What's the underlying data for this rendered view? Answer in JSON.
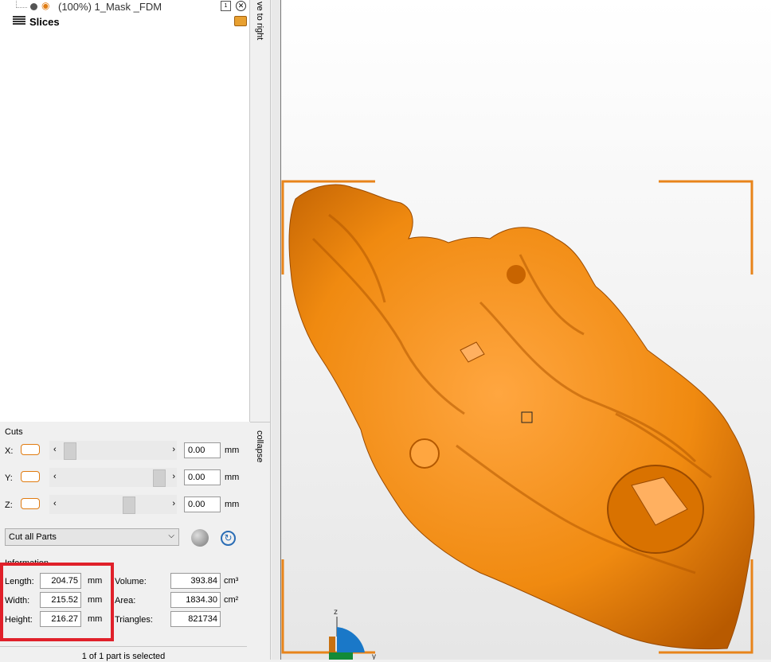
{
  "tree": {
    "part_name": "(100%) 1_Mask _FDM",
    "part_badge": "1",
    "slices_label": "Slices"
  },
  "side": {
    "move_label": "ve to right",
    "collapse_label": "collapse"
  },
  "cuts": {
    "title": "Cuts",
    "axes": [
      {
        "label": "X:",
        "value": "0.00",
        "unit": "mm",
        "thumb_pos": 0.1
      },
      {
        "label": "Y:",
        "value": "0.00",
        "unit": "mm",
        "thumb_pos": 0.9
      },
      {
        "label": "Z:",
        "value": "0.00",
        "unit": "mm",
        "thumb_pos": 0.55
      }
    ],
    "mode_selected": "Cut all Parts"
  },
  "information": {
    "title": "Information",
    "length_label": "Length:",
    "length": "204.75",
    "width_label": "Width:",
    "width": "215.52",
    "height_label": "Height:",
    "height": "216.27",
    "dim_unit": "mm",
    "volume_label": "Volume:",
    "volume": "393.84",
    "volume_unit": "cm³",
    "area_label": "Area:",
    "area": "1834.30",
    "area_unit": "cm²",
    "triangles_label": "Triangles:",
    "triangles": "821734"
  },
  "status": "1 of 1 part is selected",
  "viewport": {
    "axis_z": "z",
    "axis_y": "y",
    "model_color": "#f08a10",
    "frame_color": "#e8841a"
  }
}
